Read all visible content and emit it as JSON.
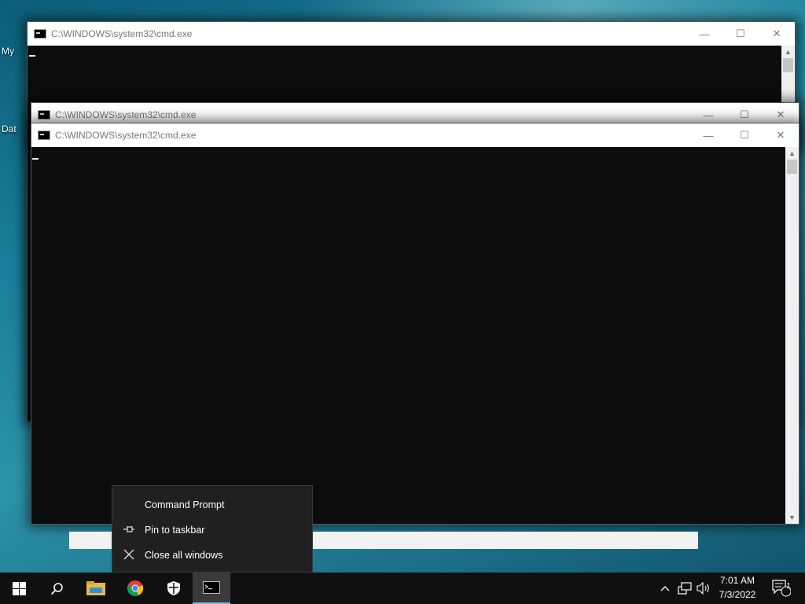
{
  "desktop": {
    "icon_labels": [
      "My",
      "Dat"
    ]
  },
  "windows": [
    {
      "title": "C:\\WINDOWS\\system32\\cmd.exe"
    },
    {
      "title": "C:\\WINDOWS\\system32\\cmd.exe"
    },
    {
      "title": "C:\\WINDOWS\\system32\\cmd.exe"
    }
  ],
  "window_controls": {
    "minimize": "—",
    "maximize": "☐",
    "close": "✕"
  },
  "context_menu": {
    "items": [
      {
        "label": "Command Prompt",
        "icon": "none"
      },
      {
        "label": "Pin to taskbar",
        "icon": "pin-icon"
      },
      {
        "label": "Close all windows",
        "icon": "close-icon"
      }
    ]
  },
  "taskbar": {
    "apps": [
      {
        "name": "start-button",
        "icon": "windows-logo-icon"
      },
      {
        "name": "search-button",
        "icon": "search-icon"
      },
      {
        "name": "file-explorer",
        "icon": "folder-icon"
      },
      {
        "name": "chrome",
        "icon": "chrome-icon"
      },
      {
        "name": "windows-security",
        "icon": "shield-icon"
      },
      {
        "name": "command-prompt",
        "icon": "cmd-icon"
      }
    ],
    "clock_time": "7:01 AM",
    "clock_date": "7/3/2022",
    "notification_count": "1"
  },
  "colors": {
    "accent": "#7fb5d8",
    "taskbar": "#101010",
    "console": "#0c0c0c"
  }
}
